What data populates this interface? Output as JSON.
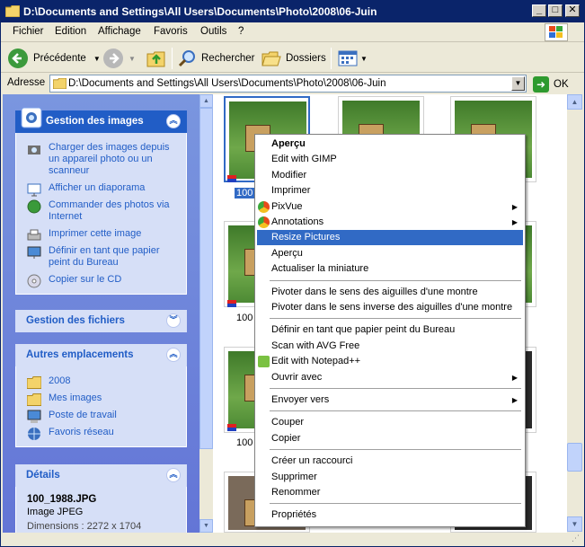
{
  "window": {
    "title": "D:\\Documents and Settings\\All Users\\Documents\\Photo\\2008\\06-Juin",
    "controls": {
      "minimize": "_",
      "maximize": "□",
      "close": "✕"
    }
  },
  "menu": [
    "Fichier",
    "Edition",
    "Affichage",
    "Favoris",
    "Outils",
    "?"
  ],
  "toolbar": {
    "back_label": "Précédente",
    "search_label": "Rechercher",
    "folders_label": "Dossiers"
  },
  "address": {
    "label": "Adresse",
    "value": "D:\\Documents and Settings\\All Users\\Documents\\Photo\\2008\\06-Juin",
    "go_label": "OK"
  },
  "left_panels": {
    "image_tasks": {
      "title": "Gestion des images",
      "items": [
        "Charger des images depuis un appareil photo ou un scanneur",
        "Afficher un diaporama",
        "Commander des photos via Internet",
        "Imprimer cette image",
        "Définir en tant que papier peint du Bureau",
        "Copier sur le CD"
      ]
    },
    "file_tasks": {
      "title": "Gestion des fichiers"
    },
    "other_places": {
      "title": "Autres emplacements",
      "items": [
        "2008",
        "Mes images",
        "Poste de travail",
        "Favoris réseau"
      ]
    },
    "details": {
      "title": "Détails",
      "filename": "100_1988.JPG",
      "type": "Image JPEG",
      "partial": "Dimensions : 2272 x 1704"
    }
  },
  "thumbnails": {
    "captions": [
      "100",
      "100",
      "100"
    ]
  },
  "context_menu": {
    "items": [
      {
        "label": "Aperçu",
        "bold": true
      },
      {
        "label": "Edit with GIMP"
      },
      {
        "label": "Modifier"
      },
      {
        "label": "Imprimer"
      },
      {
        "label": "PixVue",
        "submenu": true,
        "icon": "pixvue-icon"
      },
      {
        "label": "Annotations",
        "submenu": true,
        "icon": "annotations-icon"
      },
      {
        "label": "Resize Pictures",
        "highlight": true
      },
      {
        "label": "Aperçu"
      },
      {
        "label": "Actualiser la miniature"
      },
      {
        "divider": true
      },
      {
        "label": "Pivoter dans le sens des aiguilles d'une montre"
      },
      {
        "label": "Pivoter dans le sens inverse des aiguilles d'une montre"
      },
      {
        "divider": true
      },
      {
        "label": "Définir en tant que papier peint du Bureau"
      },
      {
        "label": "Scan with AVG Free"
      },
      {
        "label": "Edit with Notepad++",
        "icon": "notepad-icon"
      },
      {
        "label": "Ouvrir avec",
        "submenu": true
      },
      {
        "divider": true
      },
      {
        "label": "Envoyer vers",
        "submenu": true
      },
      {
        "divider": true
      },
      {
        "label": "Couper"
      },
      {
        "label": "Copier"
      },
      {
        "divider": true
      },
      {
        "label": "Créer un raccourci"
      },
      {
        "label": "Supprimer"
      },
      {
        "label": "Renommer"
      },
      {
        "divider": true
      },
      {
        "label": "Propriétés"
      }
    ]
  },
  "colors": {
    "titlebar": "#0a246a",
    "highlight": "#316ac5",
    "task_link": "#215dc6",
    "pane_blue": "#6f86d6"
  }
}
